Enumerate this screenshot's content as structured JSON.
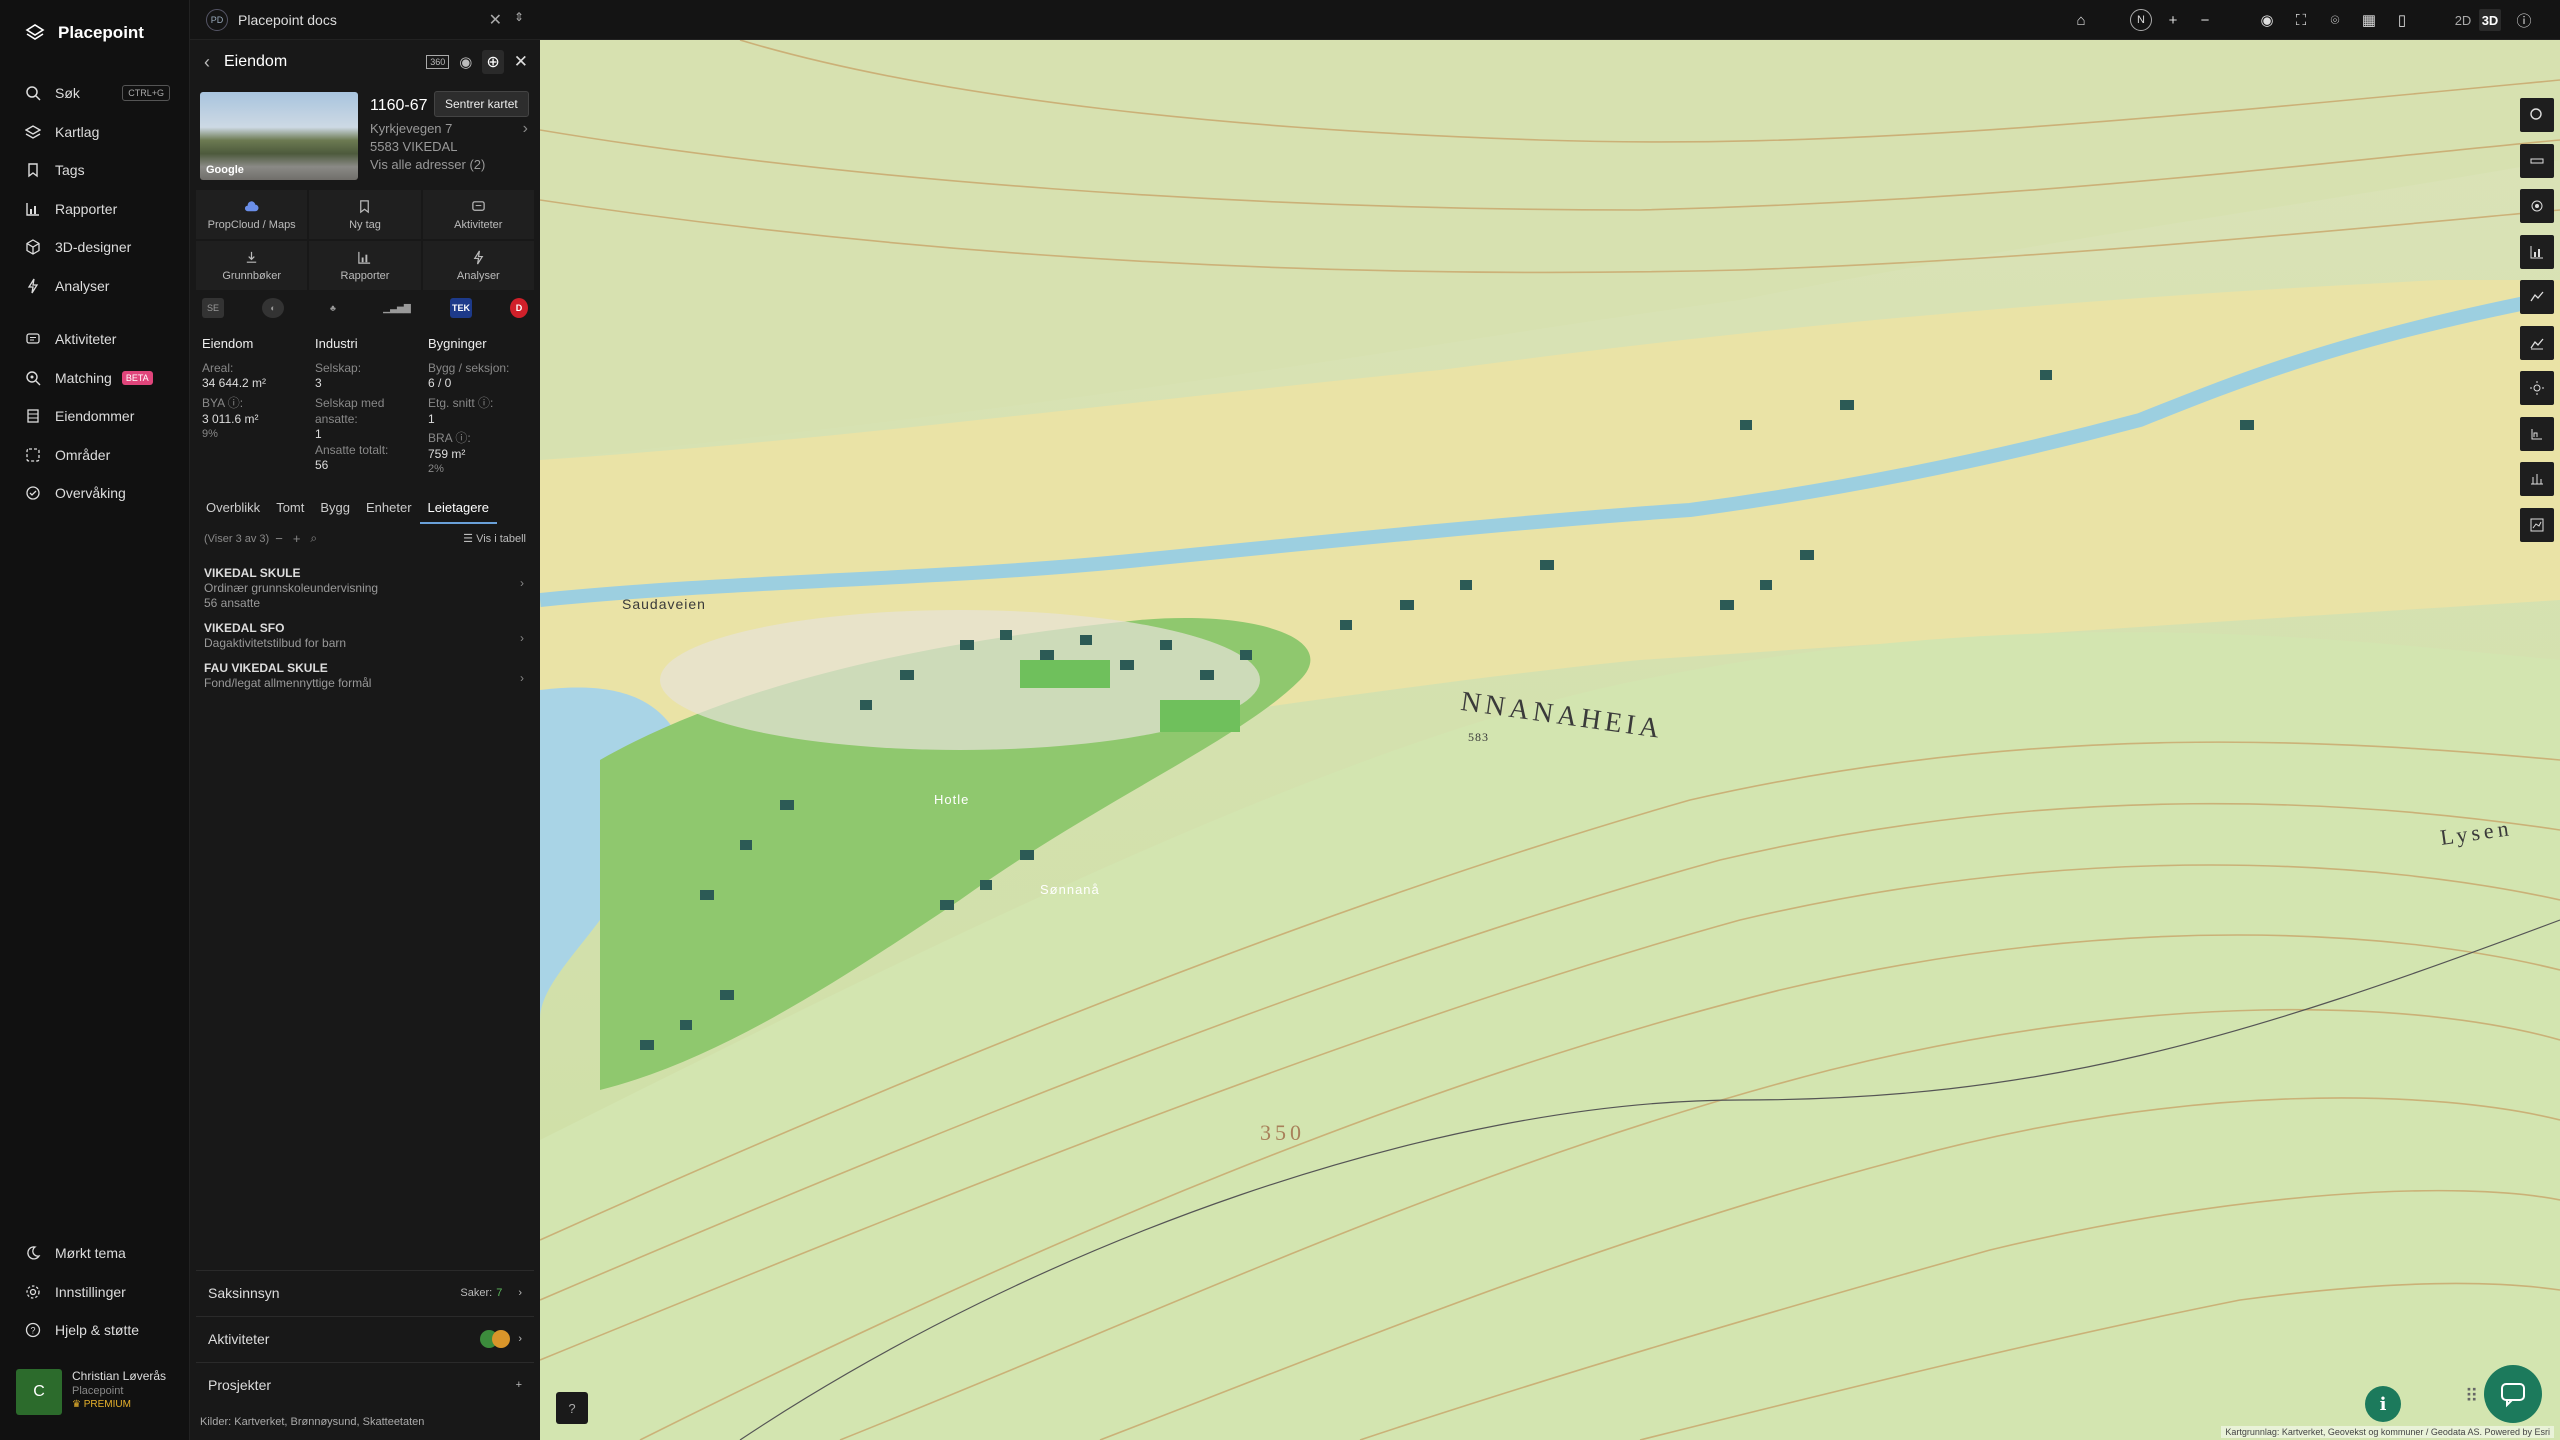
{
  "app": {
    "name": "Placepoint"
  },
  "nav": {
    "items": [
      {
        "label": "Søk",
        "shortcut": "CTRL+G"
      },
      {
        "label": "Kartlag"
      },
      {
        "label": "Tags"
      },
      {
        "label": "Rapporter"
      },
      {
        "label": "3D-designer"
      },
      {
        "label": "Analyser"
      }
    ],
    "items2": [
      {
        "label": "Aktiviteter"
      },
      {
        "label": "Matching",
        "badge": "BETA"
      },
      {
        "label": "Eiendommer"
      },
      {
        "label": "Områder"
      },
      {
        "label": "Overvåking"
      }
    ],
    "bottom": [
      {
        "label": "Mørkt tema"
      },
      {
        "label": "Innstillinger"
      },
      {
        "label": "Hjelp & støtte"
      }
    ],
    "user": {
      "initial": "C",
      "name": "Christian Løverås",
      "org": "Placepoint",
      "plan": "PREMIUM"
    }
  },
  "docbar": {
    "badge": "PD",
    "title": "Placepoint docs"
  },
  "topbar": {
    "compass": "N",
    "mode_2d": "2D",
    "mode_3d": "3D"
  },
  "panel": {
    "title": "Eiendom",
    "tooltip": "Sentrer kartet",
    "photo_label": "Google",
    "property": {
      "id": "1160-67",
      "address": "Kyrkjevegen 7",
      "postal": "5583 VIKEDAL",
      "all_addresses": "Vis alle adresser (2)"
    },
    "actions": [
      {
        "label": "PropCloud / Maps"
      },
      {
        "label": "Ny tag"
      },
      {
        "label": "Aktiviteter"
      },
      {
        "label": "Grunnbøker"
      },
      {
        "label": "Rapporter"
      },
      {
        "label": "Analyser"
      }
    ],
    "sources": {
      "tek": "TEK",
      "d": "D"
    },
    "stats": {
      "eiendom": {
        "header": "Eiendom",
        "areal_label": "Areal:",
        "areal_value": "34 644.2 m²",
        "bya_label": "BYA ⓘ:",
        "bya_value": "3 011.6 m²",
        "bya_pct": "9%"
      },
      "industri": {
        "header": "Industri",
        "selskap_label": "Selskap:",
        "selskap_value": "3",
        "ansatte_label": "Selskap med ansatte:",
        "ansatte_value": "1",
        "ansatte_tot_label": "Ansatte totalt:",
        "ansatte_tot_value": "56"
      },
      "bygninger": {
        "header": "Bygninger",
        "bygg_label": "Bygg / seksjon:",
        "bygg_value": "6 / 0",
        "etg_label": "Etg. snitt ⓘ:",
        "etg_value": "1",
        "bra_label": "BRA ⓘ:",
        "bra_value": "759 m²",
        "bra_pct": "2%"
      }
    },
    "tabs": [
      "Overblikk",
      "Tomt",
      "Bygg",
      "Enheter",
      "Leietagere"
    ],
    "list_count": "(Viser 3 av 3)",
    "table_link": "Vis i tabell",
    "tenants": [
      {
        "name": "VIKEDAL SKULE",
        "desc": "Ordinær grunnskoleundervisning",
        "extra": "56 ansatte"
      },
      {
        "name": "VIKEDAL SFO",
        "desc": "Dagaktivitetstilbud for barn",
        "extra": ""
      },
      {
        "name": "FAU VIKEDAL SKULE",
        "desc": "Fond/legat allmennyttige formål",
        "extra": ""
      }
    ],
    "sections": {
      "saksinnsyn": "Saksinnsyn",
      "saker_label": "Saker:",
      "saker_count": "7",
      "aktiviteter": "Aktiviteter",
      "prosjekter": "Prosjekter",
      "prosjekter_action": "+"
    },
    "kilder": {
      "label": "Kilder:",
      "sources": "Kartverket, Brønnøysund, Skatteetaten"
    }
  },
  "map": {
    "labels": {
      "place": "NNANAHEIA",
      "lysen": "Lysen",
      "elev": "350",
      "saudaveien": "Saudaveien",
      "hotle": "Hotle",
      "sonnanå": "Sønnanå",
      "elev2": "583"
    },
    "attribution": "Kartgrunnlag: Kartverket, Geovekst og kommuner / Geodata AS. Powered by Esri"
  },
  "colors": {
    "accent": "#1c7a5c",
    "beta": "#e0457b",
    "premium": "#e8b22c",
    "tab_underline": "#6aa0d8"
  }
}
